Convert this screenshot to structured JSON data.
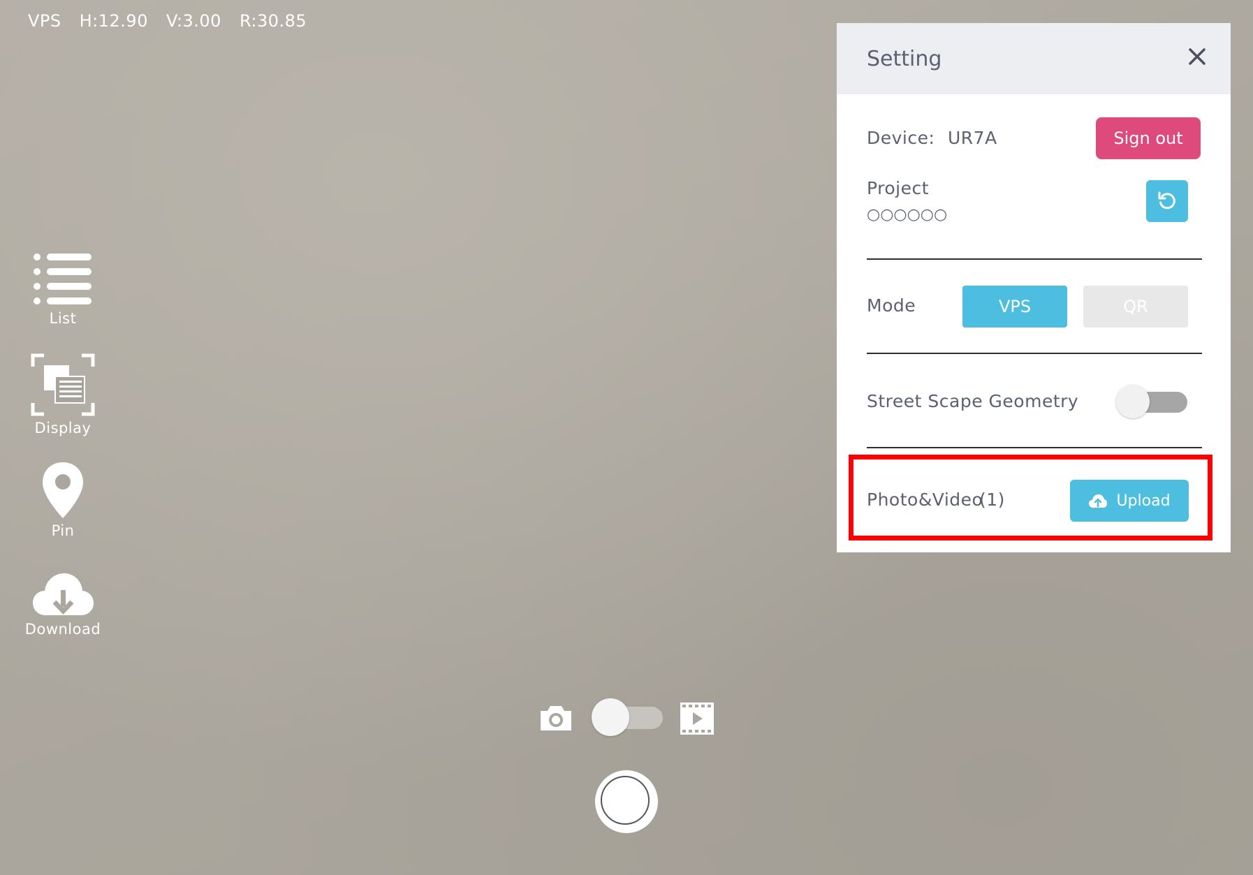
{
  "status": {
    "mode": "VPS",
    "h": "H:12.90",
    "v": "V:3.00",
    "r": "R:30.85"
  },
  "side_menu": {
    "list_label": "List",
    "display_label": "Display",
    "pin_label": "Pin",
    "download_label": "Download"
  },
  "setting": {
    "title": "Setting",
    "device_label": "Device:",
    "device_value": "UR7A",
    "signout_label": "Sign out",
    "project_label": "Project",
    "project_value": "○○○○○○",
    "mode_label": "Mode",
    "mode_options": [
      "VPS",
      "QR"
    ],
    "mode_selected": "VPS",
    "streetscape_label": "Street Scape Geometry",
    "streetscape_on": false,
    "photo_video_label": "Photo&Video",
    "photo_video_count": "(1)",
    "upload_label": "Upload"
  },
  "colors": {
    "accent": "#4dbde0",
    "signout": "#de4a7c",
    "highlight": "#ff0000",
    "panel_header": "#edeef2",
    "text": "#5b6170"
  },
  "icons": {
    "list": "list-icon",
    "display": "display-icon",
    "pin": "pin-icon",
    "download": "cloud-download-icon",
    "close": "close-icon",
    "refresh": "refresh-icon",
    "upload": "cloud-upload-icon",
    "photo": "camera-icon",
    "video": "video-icon"
  }
}
